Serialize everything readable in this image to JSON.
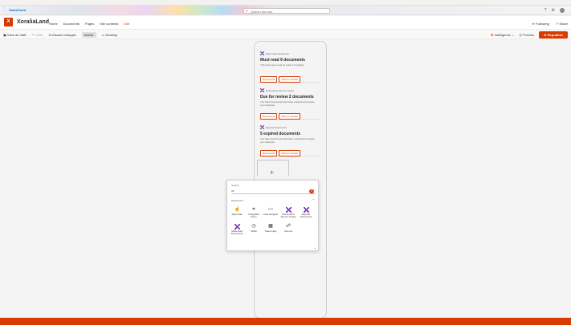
{
  "suite": {
    "app_name": "SharePoint",
    "search_placeholder": "Search this site"
  },
  "site": {
    "logo_letter": "X",
    "name": "XoraliaLand",
    "nav": [
      "Home",
      "Documents",
      "Pages",
      "Site contents",
      "Edit"
    ],
    "actions": {
      "following": "Following",
      "share": "Share"
    }
  },
  "commandbar": {
    "save_draft": "Save as draft",
    "undo": "Undo",
    "discard": "Discard changes",
    "mobile": "Mobile",
    "desktop": "Desktop",
    "intelligence": "Intelligence",
    "preview": "Preview",
    "republish": "Republish"
  },
  "cards": [
    {
      "kicker": "Must read documents",
      "title": "Must read 9 documents",
      "desc": "This document must be read in 10 day(s)",
      "btn1": "Documents",
      "btn2": "View on Xoralia"
    },
    {
      "kicker": "Documents due for review",
      "title": "Due for review 2 documents",
      "desc": "You have documents that have expired and require your attention",
      "btn1": "Documents",
      "btn2": "View on Xoralia"
    },
    {
      "kicker": "Expired documents",
      "title": "5 expired documents",
      "desc": "You have documents that have expired and require your attention",
      "btn1": "Documents",
      "btn2": "View on Xoralia"
    }
  ],
  "picker": {
    "label": "Search",
    "query": "All",
    "section": "Dashboard",
    "tiles": [
      {
        "label": "Approvals",
        "icon": "approvals-icon",
        "glyph": "☝"
      },
      {
        "label": "Integrated Items",
        "icon": "integrated-items-icon",
        "glyph": "⌗"
      },
      {
        "label": "Card designer",
        "icon": "card-designer-icon",
        "glyph": "▭"
      },
      {
        "label": "Documents due for review",
        "icon": "xoralia-logo-icon",
        "glyph": ""
      },
      {
        "label": "Expired documents",
        "icon": "xoralia-logo-icon",
        "glyph": ""
      },
      {
        "label": "Must read documents",
        "icon": "xoralia-logo-icon",
        "glyph": ""
      },
      {
        "label": "Shifts",
        "icon": "shifts-icon",
        "glyph": "◷"
      },
      {
        "label": "Teams app",
        "icon": "teams-app-icon",
        "glyph": "▦"
      },
      {
        "label": "Viva Go",
        "icon": "viva-go-icon",
        "glyph": "☍"
      }
    ]
  },
  "colors": {
    "accent": "#d83b01",
    "xoralia_purple": "#6b2fa3"
  }
}
